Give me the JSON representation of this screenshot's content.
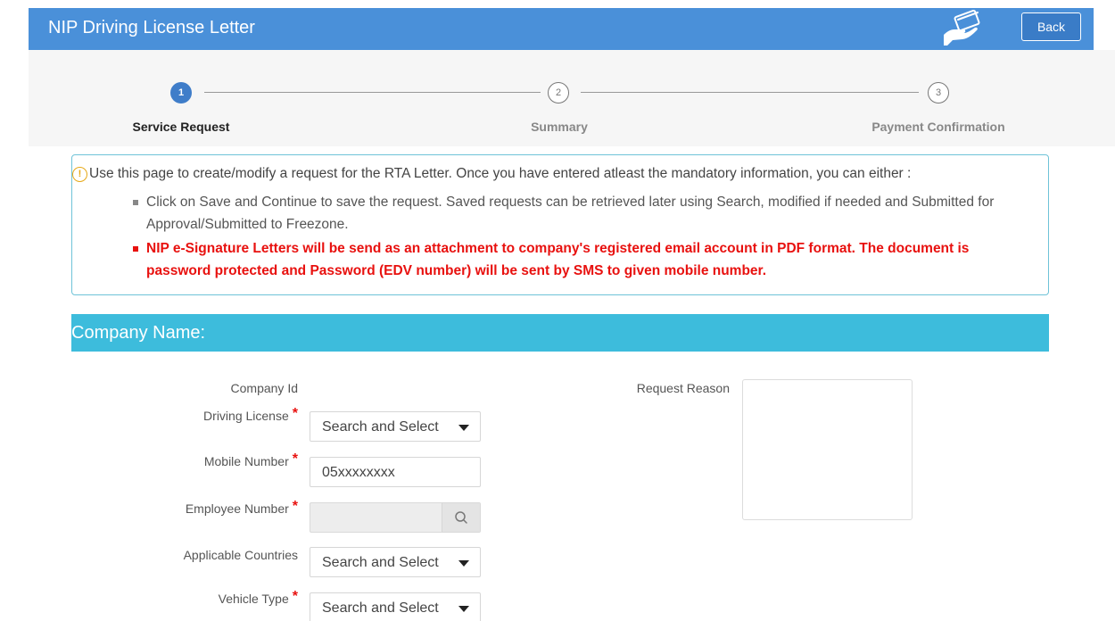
{
  "header": {
    "title": "NIP Driving License Letter",
    "back_label": "Back"
  },
  "steps": [
    {
      "number": "1",
      "label": "Service Request",
      "state": "active"
    },
    {
      "number": "2",
      "label": "Summary",
      "state": "inactive"
    },
    {
      "number": "3",
      "label": "Payment Confirmation",
      "state": "inactive"
    }
  ],
  "info": {
    "intro": "Use this page to create/modify a request for the RTA Letter. Once you have entered atleast the mandatory information, you can either :",
    "bullet_1": "Click on Save and Continue to save the request. Saved requests can be retrieved later using Search, modified if needed and Submitted for Approval/Submitted to Freezone.",
    "bullet_2": "NIP e-Signature Letters will be send as an attachment to company's registered email account in PDF format. The document is password protected and Password (EDV number) will be sent by SMS to given mobile number."
  },
  "section": {
    "title": "Company Name:"
  },
  "form": {
    "company_id_label": "Company Id",
    "driving_license_label": "Driving License",
    "driving_license_value": "Search and Select",
    "mobile_label": "Mobile Number",
    "mobile_value": "05xxxxxxxx",
    "employee_label": "Employee Number",
    "countries_label": "Applicable Countries",
    "countries_value": "Search and Select",
    "vehicle_label": "Vehicle Type",
    "vehicle_value": "Search and Select",
    "reason_label": "Request Reason",
    "required_mark": "*"
  },
  "colors": {
    "header_bg": "#4a90d9",
    "section_bg": "#3dbcdc",
    "step_active": "#3f7dc9",
    "warning_text": "#e8110f",
    "info_border": "#6fc3d8"
  },
  "icons": {
    "card": "credit-card-hand-icon",
    "info": "info-circle-icon",
    "search": "search-icon",
    "caret": "caret-down-icon"
  }
}
